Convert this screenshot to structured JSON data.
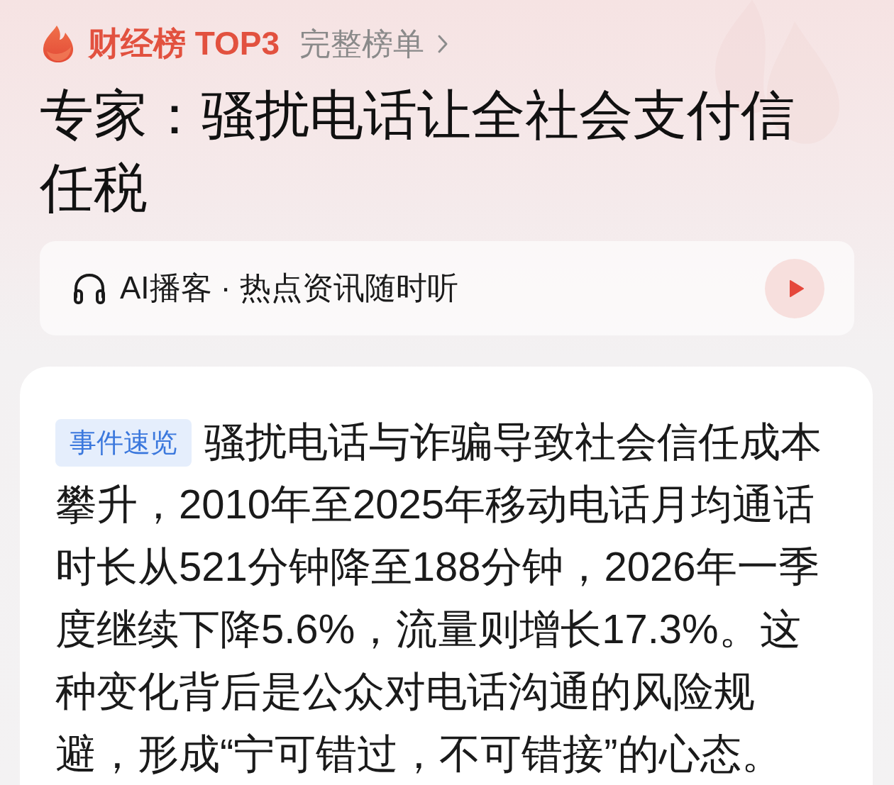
{
  "header": {
    "badge": "财经榜 TOP3",
    "link": "完整榜单"
  },
  "headline": "专家：骚扰电话让全社会支付信任税",
  "podcast_bar": {
    "label": "AI播客 · 热点资讯随时听"
  },
  "summary": {
    "tag": "事件速览",
    "text": "骚扰电话与诈骗导致社会信任成本攀升，2010年至2025年移动电话月均通话时长从521分钟降至188分钟，2026年一季度继续下降5.6%，流量则增长17.3%。这种变化背后是公众对电话沟通的风险规避，形成“宁可错过，不可错接”的心态。"
  }
}
